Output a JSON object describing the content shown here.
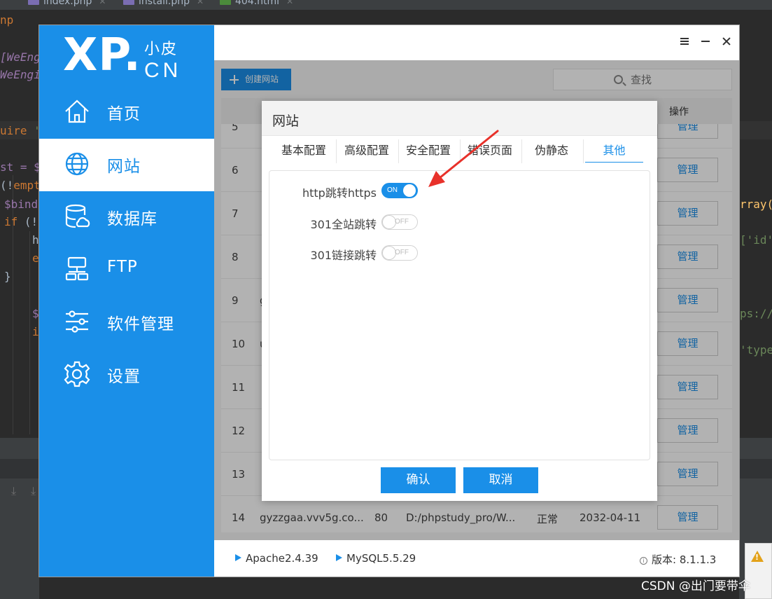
{
  "ide": {
    "tabs": [
      {
        "name": "index.php",
        "type": "php"
      },
      {
        "name": "install.php",
        "type": "php"
      },
      {
        "name": "404.html",
        "type": "html"
      }
    ],
    "code_left": {
      "l1": "np",
      "l2": "[WeEng",
      "l3": "WeEngi",
      "l4a": "uire ",
      "l4b": "'",
      "l5a": "st = ",
      "l5b": "$",
      "l6a": "(!",
      "l6b": "empt",
      "l7": "$bind",
      "l8a": "if",
      "l8b": " (!",
      "l9": "h",
      "l10": "e",
      "l11": "}",
      "l12": "$",
      "l13": "i"
    },
    "code_right": {
      "r1": "rray(",
      "r2": "['id'",
      "r3": "ps://",
      "r4": "'type"
    },
    "watermark": "CSDN @出门要带伞"
  },
  "app": {
    "logo": {
      "main": "XP.",
      "cn_top": "小皮",
      "cn_bottom": "CN"
    },
    "nav": [
      {
        "label": "首页",
        "icon": "home-icon",
        "active": false
      },
      {
        "label": "网站",
        "icon": "globe-icon",
        "active": true
      },
      {
        "label": "数据库",
        "icon": "database-icon",
        "active": false
      },
      {
        "label": "FTP",
        "icon": "ftp-icon",
        "active": false
      },
      {
        "label": "软件管理",
        "icon": "sliders-icon",
        "active": false
      },
      {
        "label": "设置",
        "icon": "gear-icon",
        "active": false
      }
    ],
    "toolbar": {
      "create_label": "创建网站",
      "search_placeholder": "查找"
    },
    "table": {
      "action_header": "操作",
      "manage_label": "管理",
      "rows": [
        {
          "index": "5",
          "name": "",
          "port": "",
          "path": "",
          "status": "",
          "expires": ""
        },
        {
          "index": "6",
          "name": "",
          "port": "",
          "path": "",
          "status": "",
          "expires": ""
        },
        {
          "index": "7",
          "name": "",
          "port": "",
          "path": "",
          "status": "",
          "expires": ""
        },
        {
          "index": "8",
          "name": "",
          "port": "",
          "path": "",
          "status": "",
          "expires": ""
        },
        {
          "index": "9",
          "name": "g",
          "port": "",
          "path": "",
          "status": "",
          "expires": ""
        },
        {
          "index": "10",
          "name": "u",
          "port": "",
          "path": "",
          "status": "",
          "expires": ""
        },
        {
          "index": "11",
          "name": "",
          "port": "",
          "path": "",
          "status": "",
          "expires": ""
        },
        {
          "index": "12",
          "name": "",
          "port": "",
          "path": "",
          "status": "",
          "expires": ""
        },
        {
          "index": "13",
          "name": "",
          "port": "",
          "path": "",
          "status": "",
          "expires": ""
        },
        {
          "index": "14",
          "name": "gyzzgaa.vvv5g.co...",
          "port": "80",
          "path": "D:/phpstudy_pro/W...",
          "status": "正常",
          "expires": "2032-04-11"
        }
      ]
    },
    "status": {
      "apache": "Apache2.4.39",
      "mysql": "MySQL5.5.29",
      "version_label": "版本:",
      "version": "8.1.1.3"
    }
  },
  "dialog": {
    "title": "网站",
    "tabs": [
      "基本配置",
      "高级配置",
      "安全配置",
      "错误页面",
      "伪静态",
      "其他"
    ],
    "active_tab": "其他",
    "options": [
      {
        "label": "http跳转https",
        "state": "ON",
        "on": true
      },
      {
        "label": "301全站跳转",
        "state": "OFF",
        "on": false
      },
      {
        "label": "301链接跳转",
        "state": "OFF",
        "on": false
      }
    ],
    "confirm_label": "确认",
    "cancel_label": "取消"
  },
  "colors": {
    "accent": "#1a8fe8",
    "annotation_arrow": "#e8312a",
    "warning": "#e3a21a"
  }
}
